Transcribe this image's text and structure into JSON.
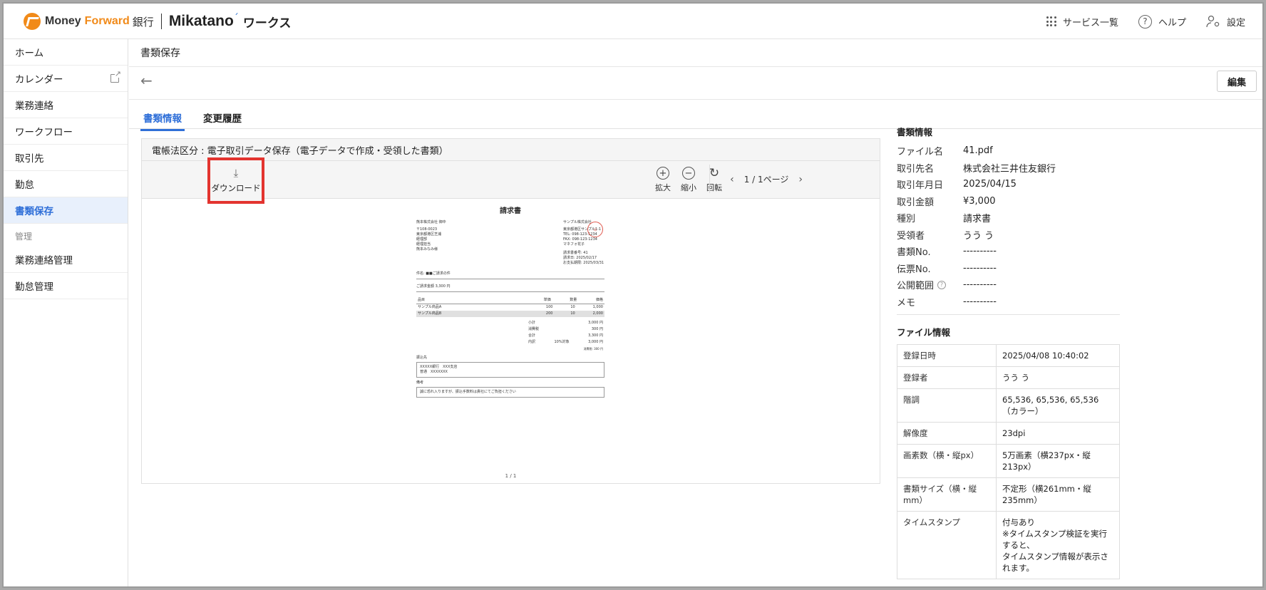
{
  "header": {
    "brand_money": "Money",
    "brand_forward": "Forward",
    "brand_bank": "銀行",
    "brand_mikatano": "Mikatano",
    "brand_works": "ワークス",
    "services_label": "サービス一覧",
    "help_label": "ヘルプ",
    "settings_label": "設定"
  },
  "sidebar": {
    "items": [
      {
        "label": "ホーム"
      },
      {
        "label": "カレンダー"
      },
      {
        "label": "業務連絡"
      },
      {
        "label": "ワークフロー"
      },
      {
        "label": "取引先"
      },
      {
        "label": "勤怠"
      },
      {
        "label": "書類保存"
      }
    ],
    "section_label": "管理",
    "admin_items": [
      {
        "label": "業務連絡管理"
      },
      {
        "label": "勤怠管理"
      }
    ]
  },
  "page": {
    "title": "書類保存",
    "edit_label": "編集",
    "tabs": [
      {
        "label": "書類情報"
      },
      {
        "label": "変更履歴"
      }
    ]
  },
  "viewer": {
    "category": "電帳法区分 : 電子取引データ保存（電子データで作成・受領した書類）",
    "download_label": "ダウンロード",
    "zoom_in_label": "拡大",
    "zoom_out_label": "縮小",
    "rotate_label": "回転",
    "page_indicator": "1 / 1ページ",
    "page_footer": "1 / 1"
  },
  "document": {
    "title": "請求書",
    "to_name": "熊本株式会社 御中",
    "to_lines": [
      "〒108-0023",
      "東京都港区芝浦",
      "経理部",
      "経理担当",
      "熊本みなみ様"
    ],
    "from_name": "サンプル株式会社",
    "from_lines": [
      "東京都港区サンプル1-1",
      "TEL: 098-123-1234",
      "FAX: 098-123-1234",
      "マネフォ花子"
    ],
    "invoice_meta": [
      "請求書番号: 41",
      "請求日: 2025/02/17",
      "お支払期限: 2025/03/31"
    ],
    "subject": "件名: ■■ご請求の件",
    "amount_line": "ご請求金額 3,300 円",
    "col_item": "品目",
    "col_price": "単価",
    "col_qty": "数量",
    "col_amount": "価格",
    "rows": [
      {
        "name": "サンプル商品A",
        "price": "100",
        "qty": "10",
        "amount": "1,000"
      },
      {
        "name": "サンプル商品B",
        "price": "200",
        "qty": "10",
        "amount": "2,000"
      }
    ],
    "subtotal_label": "小計",
    "subtotal": "3,000 円",
    "tax_label": "消費税",
    "tax": "300 円",
    "total_label": "合計",
    "total": "3,300 円",
    "breakdown_label": "内訳",
    "breakdown_rate": "10%対象",
    "breakdown_value": "3,000 円",
    "breakdown_tax": "消費税: 300 円",
    "bank_label": "振込先",
    "bank_lines": [
      "XXXXX銀行　XXX支店",
      "普通　XXXXXXX"
    ],
    "note_label": "備考",
    "note_text": "誠に恐れ入りますが、振込手数料は貴社にてご負担ください",
    "stamp_text": "印"
  },
  "info": {
    "heading": "書類情報",
    "rows": [
      {
        "key": "ファイル名",
        "value": "41.pdf"
      },
      {
        "key": "取引先名",
        "value": "株式会社三井住友銀行"
      },
      {
        "key": "取引年月日",
        "value": "2025/04/15"
      },
      {
        "key": "取引金額",
        "value": "¥3,000"
      },
      {
        "key": "種別",
        "value": "請求書"
      },
      {
        "key": "受領者",
        "value": "うう う"
      },
      {
        "key": "書類No.",
        "value": "----------"
      },
      {
        "key": "伝票No.",
        "value": "----------"
      },
      {
        "key": "公開範囲",
        "value": "----------"
      },
      {
        "key": "メモ",
        "value": "----------"
      }
    ]
  },
  "file_info": {
    "heading": "ファイル情報",
    "rows": [
      {
        "key": "登録日時",
        "value": "2025/04/08 10:40:02"
      },
      {
        "key": "登録者",
        "value": "うう う"
      },
      {
        "key": "階調",
        "value": "65,536, 65,536, 65,536（カラー）"
      },
      {
        "key": "解像度",
        "value": "23dpi"
      },
      {
        "key": "画素数（横・縦px）",
        "value": "5万画素（横237px・縦213px）"
      },
      {
        "key": "書類サイズ（横・縦mm）",
        "value": "不定形（横261mm・縦235mm）"
      },
      {
        "key": "タイムスタンプ",
        "value": "付与あり",
        "value2": "※タイムスタンプ検証を実行すると、",
        "value3": "タイムスタンプ情報が表示されます。"
      }
    ]
  },
  "colors": {
    "accent": "#2f6fd8",
    "brand_orange": "#f18a19",
    "highlight_red": "#e3342f"
  }
}
